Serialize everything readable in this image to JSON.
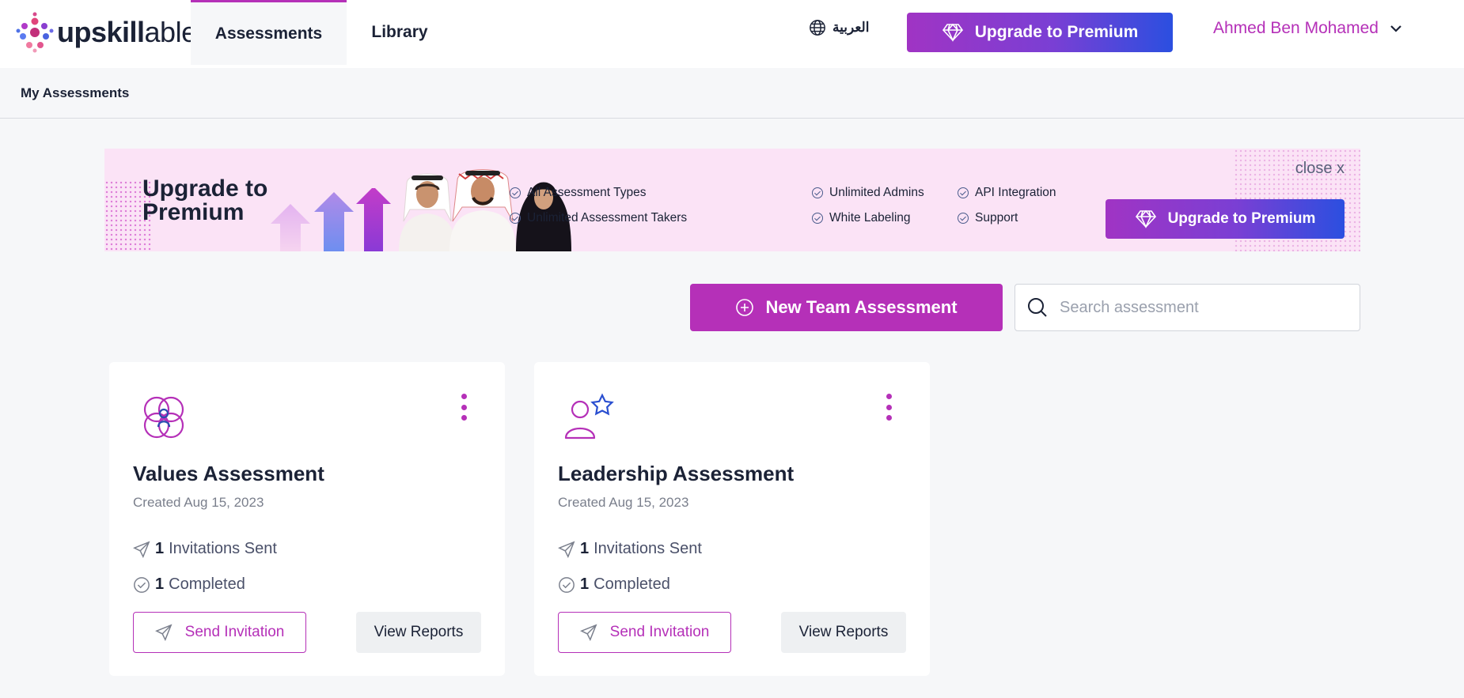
{
  "brand": {
    "logo_up": "upskill",
    "logo_able": "able"
  },
  "nav": {
    "tabs": [
      {
        "label": "Assessments"
      },
      {
        "label": "Library"
      }
    ]
  },
  "language": {
    "label": "العربية"
  },
  "header": {
    "upgrade_label": "Upgrade to Premium",
    "user_name": "Ahmed Ben Mohamed"
  },
  "breadcrumb": {
    "label": "My Assessments"
  },
  "banner": {
    "title": "Upgrade to Premium",
    "features": [
      "All Assessment Types",
      "Unlimited Assessment Takers",
      "Unlimited Admins",
      "White Labeling",
      "API Integration",
      "Support"
    ],
    "close_label": "close x",
    "upgrade_label": "Upgrade to Premium"
  },
  "toolbar": {
    "new_assessment_label": "New Team Assessment",
    "search_placeholder": "Search assessment"
  },
  "cards": [
    {
      "title": "Values Assessment",
      "created": "Created Aug 15, 2023",
      "invitations_count": "1",
      "invitations_label": "Invitations Sent",
      "completed_count": "1",
      "completed_label": "Completed",
      "send_label": "Send Invitation",
      "reports_label": "View Reports",
      "icon": "values-rings-icon"
    },
    {
      "title": "Leadership Assessment",
      "created": "Created Aug 15, 2023",
      "invitations_count": "1",
      "invitations_label": "Invitations Sent",
      "completed_count": "1",
      "completed_label": "Completed",
      "send_label": "Send Invitation",
      "reports_label": "View Reports",
      "icon": "person-star-icon"
    }
  ],
  "colors": {
    "accent": "#b530b8",
    "upgrade_gradient_start": "#a034c4",
    "upgrade_gradient_end": "#2b4fe0",
    "text": "#1b2236",
    "banner_bg": "#fbe3f6"
  }
}
